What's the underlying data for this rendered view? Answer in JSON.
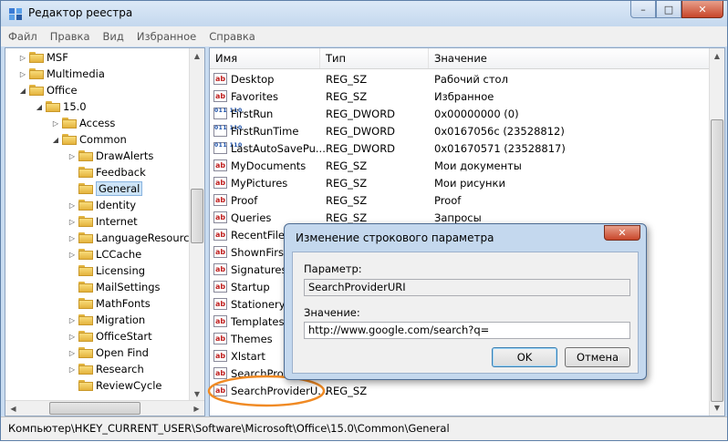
{
  "window": {
    "title": "Редактор реестра",
    "min": "–",
    "max": "□",
    "close": "✕"
  },
  "menu": [
    "Файл",
    "Правка",
    "Вид",
    "Избранное",
    "Справка"
  ],
  "tree": {
    "rows": [
      {
        "label": "MSF",
        "expander": "▷"
      },
      {
        "label": "Multimedia",
        "expander": "▷"
      },
      {
        "label": "Office",
        "expander": "◢"
      },
      {
        "label": "15.0",
        "expander": "◢"
      },
      {
        "label": "Access",
        "expander": "▷"
      },
      {
        "label": "Common",
        "expander": "◢"
      },
      {
        "label": "DrawAlerts",
        "expander": "▷"
      },
      {
        "label": "Feedback",
        "expander": ""
      },
      {
        "label": "General",
        "expander": ""
      },
      {
        "label": "Identity",
        "expander": "▷"
      },
      {
        "label": "Internet",
        "expander": "▷"
      },
      {
        "label": "LanguageResources",
        "expander": "▷"
      },
      {
        "label": "LCCache",
        "expander": "▷"
      },
      {
        "label": "Licensing",
        "expander": ""
      },
      {
        "label": "MailSettings",
        "expander": ""
      },
      {
        "label": "MathFonts",
        "expander": ""
      },
      {
        "label": "Migration",
        "expander": "▷"
      },
      {
        "label": "OfficeStart",
        "expander": "▷"
      },
      {
        "label": "Open Find",
        "expander": "▷"
      },
      {
        "label": "Research",
        "expander": "▷"
      },
      {
        "label": "ReviewCycle",
        "expander": ""
      }
    ]
  },
  "list": {
    "headers": [
      "Имя",
      "Тип",
      "Значение"
    ],
    "rows": [
      {
        "name": "Desktop",
        "type": "REG_SZ",
        "value": "Рабочий стол",
        "icon": "sz"
      },
      {
        "name": "Favorites",
        "type": "REG_SZ",
        "value": "Избранное",
        "icon": "sz"
      },
      {
        "name": "FirstRun",
        "type": "REG_DWORD",
        "value": "0x00000000 (0)",
        "icon": "dw"
      },
      {
        "name": "FirstRunTime",
        "type": "REG_DWORD",
        "value": "0x0167056c (23528812)",
        "icon": "dw"
      },
      {
        "name": "LastAutoSavePu...",
        "type": "REG_DWORD",
        "value": "0x01670571 (23528817)",
        "icon": "dw"
      },
      {
        "name": "MyDocuments",
        "type": "REG_SZ",
        "value": "Мои документы",
        "icon": "sz"
      },
      {
        "name": "MyPictures",
        "type": "REG_SZ",
        "value": "Мои рисунки",
        "icon": "sz"
      },
      {
        "name": "Proof",
        "type": "REG_SZ",
        "value": "Proof",
        "icon": "sz"
      },
      {
        "name": "Queries",
        "type": "REG_SZ",
        "value": "Запросы",
        "icon": "sz"
      },
      {
        "name": "RecentFiles",
        "type": "",
        "value": "",
        "icon": "sz"
      },
      {
        "name": "ShownFirstRu...",
        "type": "",
        "value": "",
        "icon": "sz"
      },
      {
        "name": "Signatures",
        "type": "",
        "value": "",
        "icon": "sz"
      },
      {
        "name": "Startup",
        "type": "",
        "value": "",
        "icon": "sz"
      },
      {
        "name": "Stationery",
        "type": "",
        "value": "",
        "icon": "sz"
      },
      {
        "name": "Templates",
        "type": "",
        "value": "",
        "icon": "sz"
      },
      {
        "name": "Themes",
        "type": "",
        "value": "",
        "icon": "sz"
      },
      {
        "name": "Xlstart",
        "type": "",
        "value": "",
        "icon": "sz"
      },
      {
        "name": "SearchProvi...",
        "type": "",
        "value": "",
        "icon": "sz"
      },
      {
        "name": "SearchProviderU...",
        "type": "REG_SZ",
        "value": "",
        "icon": "sz"
      }
    ]
  },
  "icons": {
    "sz": "ab",
    "dw": "011 110"
  },
  "status": "Компьютер\\HKEY_CURRENT_USER\\Software\\Microsoft\\Office\\15.0\\Common\\General",
  "dialog": {
    "title": "Изменение строкового параметра",
    "close": "✕",
    "param_label": "Параметр:",
    "param_value": "SearchProviderURI",
    "value_label": "Значение:",
    "value": "http://www.google.com/search?q=",
    "ok": "OK",
    "cancel": "Отмена"
  },
  "colors": {
    "highlight": "#f08a24",
    "selection": "#cde4f7",
    "accent": "#3c7fb1"
  }
}
